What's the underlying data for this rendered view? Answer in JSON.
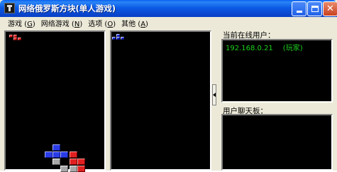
{
  "window": {
    "title": "网络俄罗斯方块(单人游戏)",
    "minimize_label": "",
    "maximize_label": "",
    "close_label": "✕"
  },
  "menu": [
    {
      "label": "游戏",
      "key": "G"
    },
    {
      "label": "网络游戏",
      "key": "N"
    },
    {
      "label": "选项",
      "key": "O"
    },
    {
      "label": "其他",
      "key": "A"
    }
  ],
  "panels": {
    "online_users_label": "当前在线用户：",
    "online_users": [
      {
        "ip": "192.168.0.21",
        "nick": "(玩家)"
      }
    ],
    "chat_label": "用户聊天板："
  },
  "colors": {
    "title_bar": "#0a5ff0",
    "board_background": "#000000",
    "online_text": "#1ed21e",
    "block_red": "#e02020",
    "block_blue": "#2a3ce8",
    "block_gray": "#a8a8a8"
  }
}
